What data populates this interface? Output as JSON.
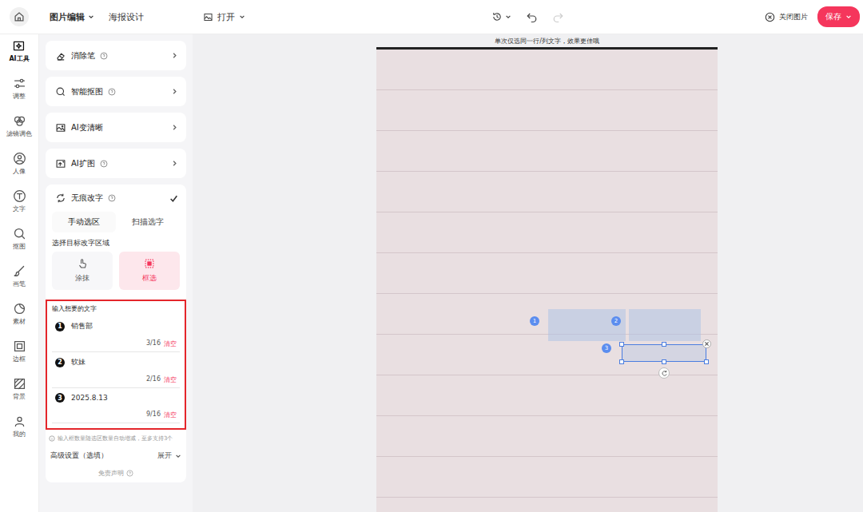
{
  "topbar": {
    "tabs": [
      {
        "label": "图片编辑",
        "selected": true,
        "dropdown": true
      },
      {
        "label": "海报设计",
        "selected": false,
        "dropdown": false
      }
    ],
    "open_button": "打开",
    "undo": {
      "enabled": true
    },
    "redo": {
      "enabled": false
    },
    "close_button": "关闭图片",
    "save_button": "保存"
  },
  "rail": [
    {
      "label": "AI工具",
      "selected": true
    },
    {
      "label": "调整",
      "selected": false
    },
    {
      "label": "滤镜调色",
      "selected": false
    },
    {
      "label": "人像",
      "selected": false
    },
    {
      "label": "文字",
      "selected": false
    },
    {
      "label": "抠图",
      "selected": false
    },
    {
      "label": "画笔",
      "selected": false
    },
    {
      "label": "素材",
      "selected": false
    },
    {
      "label": "边框",
      "selected": false
    },
    {
      "label": "背景",
      "selected": false
    },
    {
      "label": "我的",
      "selected": false
    }
  ],
  "tools": [
    {
      "label": "消除笔",
      "info": true
    },
    {
      "label": "智能抠图",
      "info": true
    },
    {
      "label": "AI变清晰",
      "info": false
    },
    {
      "label": "AI扩图",
      "info": true
    }
  ],
  "active_tool": {
    "label": "无痕改字",
    "info": true,
    "expanded": true,
    "mode_tabs": [
      {
        "label": "手动选区",
        "selected": true
      },
      {
        "label": "扫描选字",
        "selected": false
      }
    ],
    "area_label": "选择目标改字区域",
    "area_modes": [
      {
        "label": "涂抹",
        "selected": false
      },
      {
        "label": "框选",
        "selected": true
      }
    ],
    "input_title": "输入想要的文字",
    "inputs": [
      {
        "index": "1",
        "value": "销售部",
        "count": "3/16",
        "clear": "清空"
      },
      {
        "index": "2",
        "value": "软妹",
        "count": "2/16",
        "clear": "清空"
      },
      {
        "index": "3",
        "value": "2025.8.13",
        "count": "9/16",
        "clear": "清空"
      }
    ],
    "hint": "输入框数量随选区数量自动增减，至多支持3个",
    "advanced": {
      "label": "高级设置（选填）",
      "toggle": "展开"
    },
    "disclaimer": "免责声明"
  },
  "canvas": {
    "hint": "单次仅选同一行/列文字，效果更佳哦",
    "selections": [
      {
        "index": "1",
        "selected": false
      },
      {
        "index": "2",
        "selected": false
      },
      {
        "index": "3",
        "selected": true
      }
    ]
  }
}
